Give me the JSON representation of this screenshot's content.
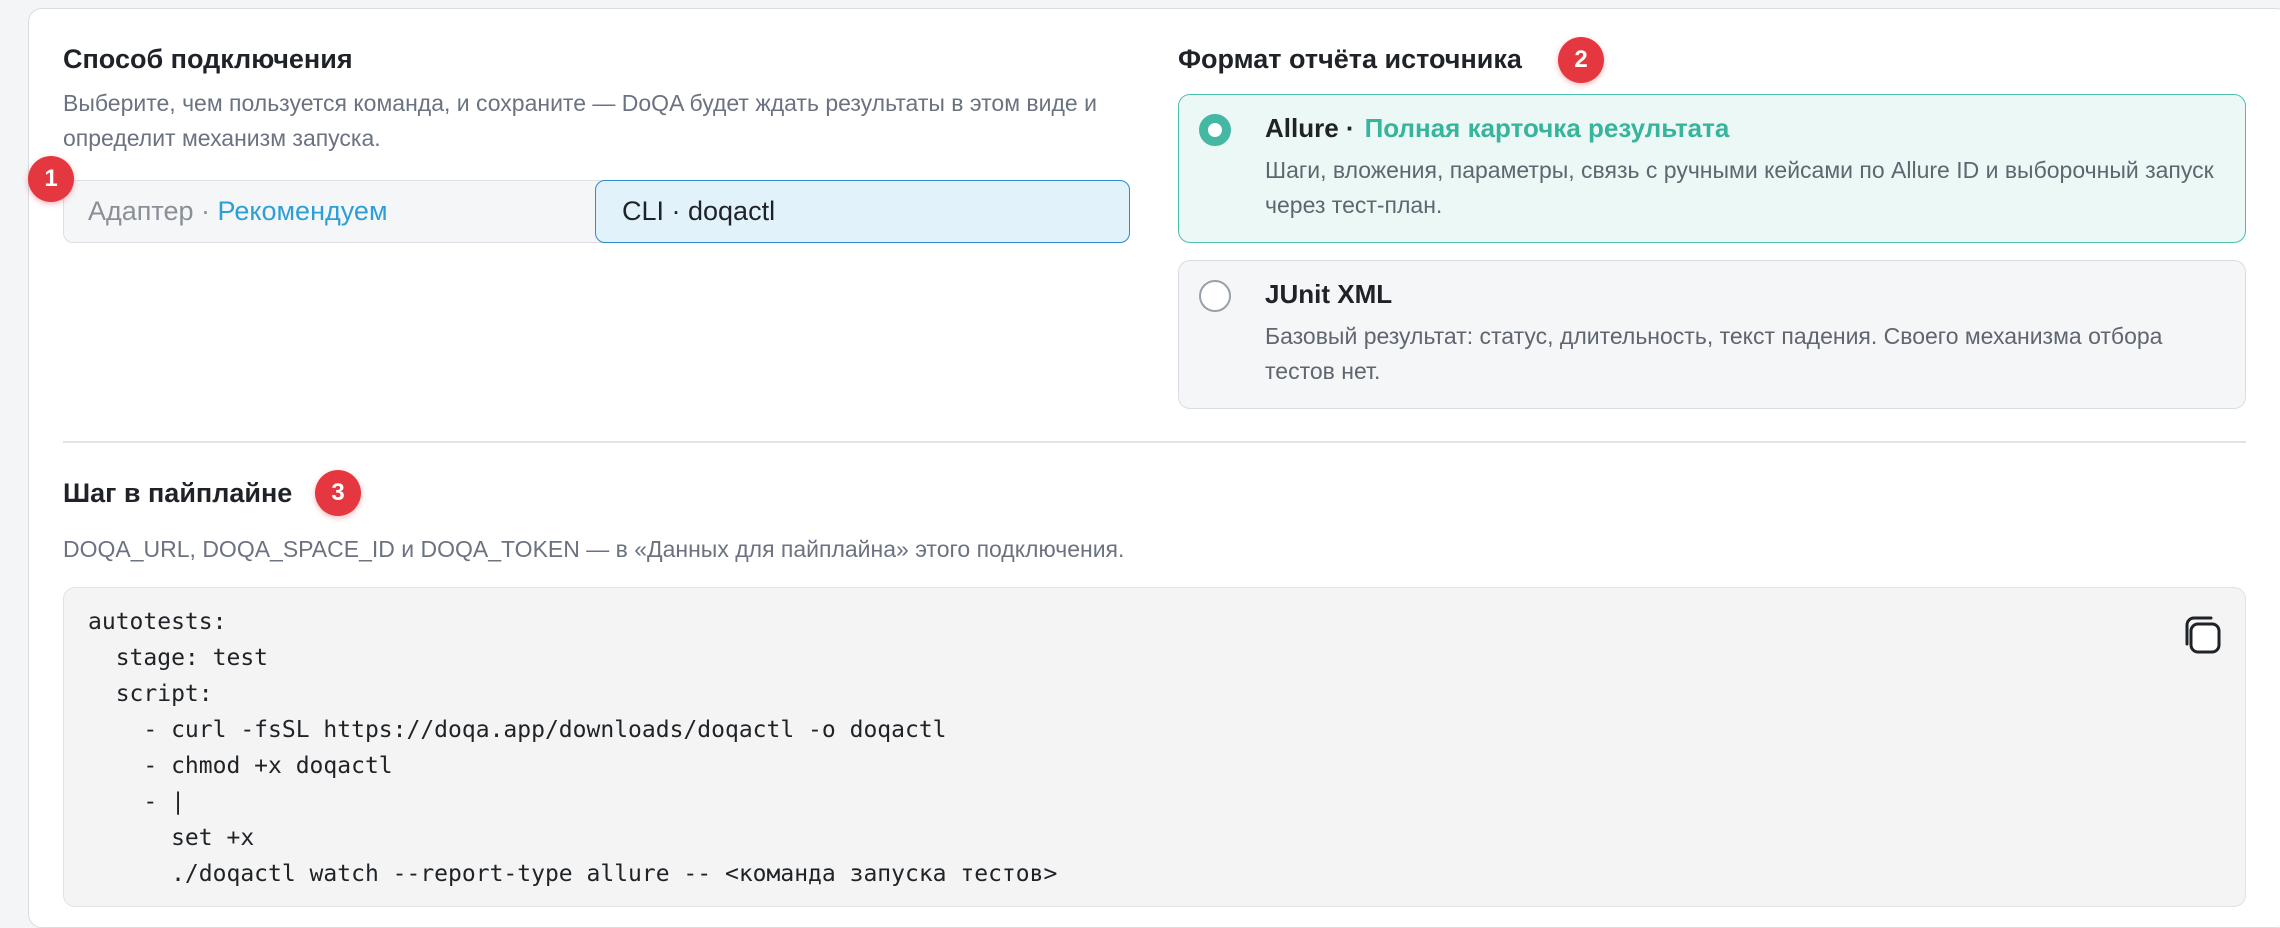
{
  "connection": {
    "title": "Способ подключения",
    "description": "Выберите, чем пользуется команда, и сохраните — DoQA будет ждать результаты в этом виде и определит механизм запуска.",
    "badge": "1",
    "options": {
      "adapter_label": "Адаптер ·",
      "adapter_tag": "Рекомендуем",
      "cli_label": "CLI · doqactl"
    },
    "selected": "CLI · doqactl"
  },
  "report_format": {
    "title": "Формат отчёта источника",
    "badge": "2",
    "options": [
      {
        "title": "Allure ·",
        "tag": "Полная карточка результата",
        "description": "Шаги, вложения, параметры, связь с ручными кейсами по Allure ID и выборочный запуск через тест-план.",
        "selected": true
      },
      {
        "title": "JUnit XML",
        "tag": "",
        "description": "Базовый результат: статус, длительность, текст падения. Своего механизма отбора тестов нет.",
        "selected": false
      }
    ]
  },
  "pipeline": {
    "title": "Шаг в пайплайне",
    "badge": "3",
    "description": "DOQA_URL, DOQA_SPACE_ID и DOQA_TOKEN — в «Данных для пайплайна» этого подключения.",
    "code_lines": [
      "autotests:",
      "  stage: test",
      "  script:",
      "    - curl -fsSL https://doqa.app/downloads/doqactl -o doqactl",
      "    - chmod +x doqactl",
      "    - |",
      "      set +x",
      "      ./doqactl watch --report-type allure -- <команда запуска тестов>"
    ],
    "copy_icon": "copy-icon"
  },
  "colors": {
    "accent_blue": "#2e9fd6",
    "accent_teal": "#45b8a4",
    "badge_red": "#e5373f"
  }
}
